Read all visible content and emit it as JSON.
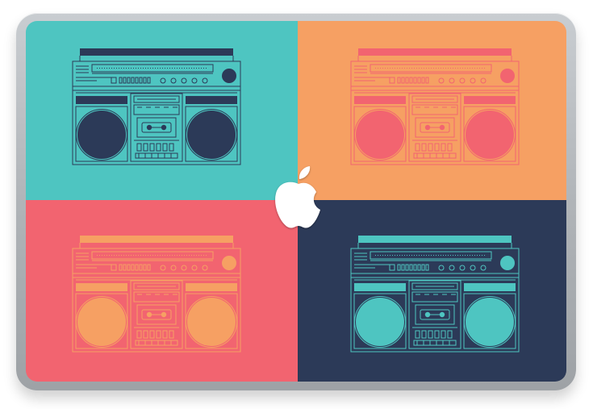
{
  "colors": {
    "teal": "#4ec5c1",
    "orange": "#f6a063",
    "coral": "#f26470",
    "navy": "#2c3a58",
    "bezel": "#b4b8bc",
    "logo": "#ffffff"
  },
  "panels": [
    {
      "position": "top-left",
      "background": "teal",
      "stroke": "navy",
      "fill": "navy"
    },
    {
      "position": "top-right",
      "background": "orange",
      "stroke": "coral",
      "fill": "coral"
    },
    {
      "position": "bottom-left",
      "background": "coral",
      "stroke": "orange",
      "fill": "orange"
    },
    {
      "position": "bottom-right",
      "background": "navy",
      "stroke": "teal",
      "fill": "teal"
    }
  ],
  "icons": {
    "boombox": "boombox-icon",
    "logo": "apple-logo-icon"
  }
}
